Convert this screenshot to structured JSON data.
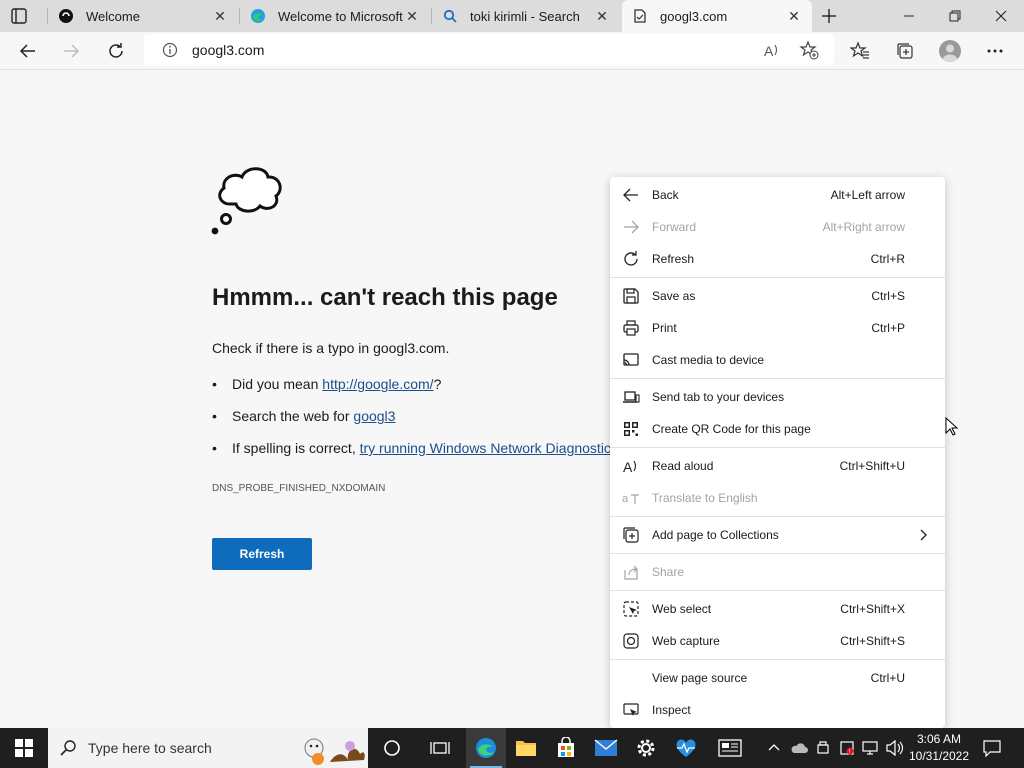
{
  "tabs": [
    {
      "title": "Welcome",
      "active": false
    },
    {
      "title": "Welcome to Microsoft E",
      "active": false
    },
    {
      "title": "toki kirimli - Search",
      "active": false
    },
    {
      "title": "googl3.com",
      "active": true
    }
  ],
  "address_bar": {
    "url": "googl3.com"
  },
  "error_page": {
    "heading": "Hmmm... can't reach this page",
    "check_text": "Check if there is a typo in googl3.com.",
    "bullet_char": "•",
    "suggestion_1_prefix": "Did you mean ",
    "suggestion_1_link": "http://google.com/",
    "suggestion_1_suffix": "?",
    "suggestion_2_prefix": "Search the web for ",
    "suggestion_2_link": "googl3",
    "suggestion_3_prefix": "If spelling is correct, ",
    "suggestion_3_link": "try running Windows Network Diagnostic",
    "error_code": "DNS_PROBE_FINISHED_NXDOMAIN",
    "refresh_label": "Refresh"
  },
  "context_menu": {
    "items": [
      {
        "label": "Back",
        "shortcut": "Alt+Left arrow",
        "icon": "back-arrow-icon",
        "disabled": false
      },
      {
        "label": "Forward",
        "shortcut": "Alt+Right arrow",
        "icon": "forward-arrow-icon",
        "disabled": true
      },
      {
        "label": "Refresh",
        "shortcut": "Ctrl+R",
        "icon": "refresh-icon",
        "disabled": false
      },
      {
        "label": "Save as",
        "shortcut": "Ctrl+S",
        "icon": "save-icon",
        "disabled": false
      },
      {
        "label": "Print",
        "shortcut": "Ctrl+P",
        "icon": "print-icon",
        "disabled": false
      },
      {
        "label": "Cast media to device",
        "shortcut": "",
        "icon": "cast-icon",
        "disabled": false
      },
      {
        "label": "Send tab to your devices",
        "shortcut": "",
        "icon": "send-tab-icon",
        "disabled": false
      },
      {
        "label": "Create QR Code for this page",
        "shortcut": "",
        "icon": "qr-code-icon",
        "disabled": false
      },
      {
        "label": "Read aloud",
        "shortcut": "Ctrl+Shift+U",
        "icon": "read-aloud-icon",
        "disabled": false
      },
      {
        "label": "Translate to English",
        "shortcut": "",
        "icon": "translate-icon",
        "disabled": true
      },
      {
        "label": "Add page to Collections",
        "shortcut": "",
        "icon": "collections-icon",
        "disabled": false
      },
      {
        "label": "Share",
        "shortcut": "",
        "icon": "share-icon",
        "disabled": true
      },
      {
        "label": "Web select",
        "shortcut": "Ctrl+Shift+X",
        "icon": "web-select-icon",
        "disabled": false
      },
      {
        "label": "Web capture",
        "shortcut": "Ctrl+Shift+S",
        "icon": "web-capture-icon",
        "disabled": false
      },
      {
        "label": "View page source",
        "shortcut": "Ctrl+U",
        "icon": "",
        "disabled": false
      },
      {
        "label": "Inspect",
        "shortcut": "",
        "icon": "inspect-icon",
        "disabled": false
      }
    ]
  },
  "taskbar": {
    "search_placeholder": "Type here to search",
    "time": "3:06 AM",
    "date": "10/31/2022"
  },
  "colors": {
    "accent": "#0f6cbd",
    "link": "#1a4f8b",
    "tabstrip": "#dcdcdc",
    "taskbar": "#1f1f1f"
  }
}
